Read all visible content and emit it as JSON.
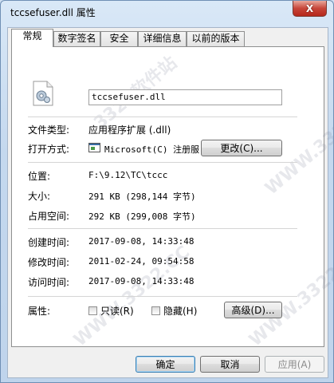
{
  "window": {
    "title": "tccsefuser.dll 属性",
    "close_label": "X"
  },
  "tabs": [
    {
      "label": "常规"
    },
    {
      "label": "数字签名"
    },
    {
      "label": "安全"
    },
    {
      "label": "详细信息"
    },
    {
      "label": "以前的版本"
    }
  ],
  "general": {
    "filename": "tccsefuser.dll",
    "file_type_label": "文件类型:",
    "file_type_value": "应用程序扩展 (.dll)",
    "open_with_label": "打开方式:",
    "open_with_value": "Microsoft(C) 注册服",
    "change_button": "更改(C)...",
    "location_label": "位置:",
    "location_value": "F:\\9.12\\TC\\tccc",
    "size_label": "大小:",
    "size_value": "291 KB (298,144 字节)",
    "size_on_disk_label": "占用空间:",
    "size_on_disk_value": "292 KB (299,008 字节)",
    "created_label": "创建时间:",
    "created_value": "2017-09-08, 14:33:48",
    "modified_label": "修改时间:",
    "modified_value": "2011-02-24, 09:54:58",
    "accessed_label": "访问时间:",
    "accessed_value": "2017-09-08, 14:33:48",
    "attributes_label": "属性:",
    "readonly_label": "只读(R)",
    "readonly_checked": false,
    "hidden_label": "隐藏(H)",
    "hidden_checked": false,
    "advanced_button": "高级(D)..."
  },
  "footer": {
    "ok_button": "确定",
    "cancel_button": "取消",
    "apply_button": "应用(A)"
  },
  "watermark": {
    "text1": "3322软件站",
    "text2": "WWW.3322.CC"
  }
}
